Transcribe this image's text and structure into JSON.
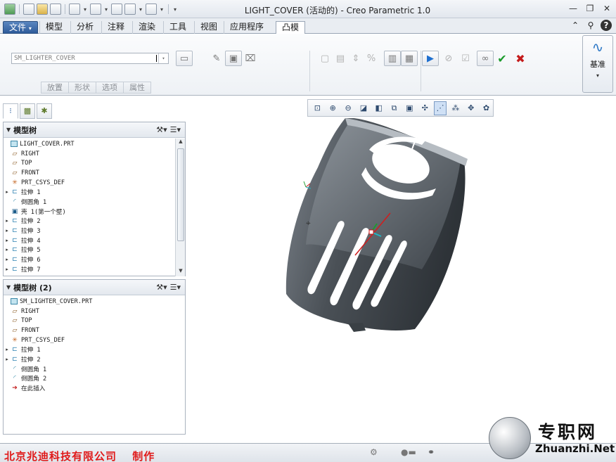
{
  "window": {
    "title": "LIGHT_COVER (活动的) - Creo Parametric 1.0"
  },
  "tabs": [
    {
      "label": "文件",
      "dropdown": "▾"
    },
    {
      "label": "模型"
    },
    {
      "label": "分析"
    },
    {
      "label": "注释"
    },
    {
      "label": "渲染"
    },
    {
      "label": "工具"
    },
    {
      "label": "视图"
    },
    {
      "label": "应用程序"
    },
    {
      "label": "凸模"
    }
  ],
  "ribbon": {
    "combo_value": "SM_LIGHTER_COVER",
    "panel_tabs": [
      "放置",
      "形状",
      "选项",
      "属性"
    ],
    "datum_label": "基准"
  },
  "tree1": {
    "title": "模型树",
    "items": [
      {
        "label": "LIGHT_COVER.PRT",
        "icon": "part-icon",
        "expand": ""
      },
      {
        "label": "RIGHT",
        "icon": "plane-icon",
        "expand": ""
      },
      {
        "label": "TOP",
        "icon": "plane-icon",
        "expand": ""
      },
      {
        "label": "FRONT",
        "icon": "plane-icon",
        "expand": ""
      },
      {
        "label": "PRT_CSYS_DEF",
        "icon": "csys-icon",
        "expand": ""
      },
      {
        "label": "拉伸 1",
        "icon": "extrude-icon",
        "expand": "▸"
      },
      {
        "label": "倒圆角 1",
        "icon": "round-icon",
        "expand": ""
      },
      {
        "label": "壳 1(第一个壁)",
        "icon": "shell-icon",
        "expand": ""
      },
      {
        "label": "拉伸 2",
        "icon": "extrude-icon",
        "expand": "▸"
      },
      {
        "label": "拉伸 3",
        "icon": "extrude-icon",
        "expand": "▸"
      },
      {
        "label": "拉伸 4",
        "icon": "extrude-icon",
        "expand": "▸"
      },
      {
        "label": "拉伸 5",
        "icon": "extrude-icon",
        "expand": "▸"
      },
      {
        "label": "拉伸 6",
        "icon": "extrude-icon",
        "expand": "▸"
      },
      {
        "label": "拉伸 7",
        "icon": "extrude-icon",
        "expand": "▸"
      }
    ]
  },
  "tree2": {
    "title": "模型树 (2)",
    "items": [
      {
        "label": "SM_LIGHTER_COVER.PRT",
        "icon": "part-icon",
        "expand": ""
      },
      {
        "label": "RIGHT",
        "icon": "plane-icon",
        "expand": ""
      },
      {
        "label": "TOP",
        "icon": "plane-icon",
        "expand": ""
      },
      {
        "label": "FRONT",
        "icon": "plane-icon",
        "expand": ""
      },
      {
        "label": "PRT_CSYS_DEF",
        "icon": "csys-icon",
        "expand": ""
      },
      {
        "label": "拉伸 1",
        "icon": "extrude-icon",
        "expand": "▸"
      },
      {
        "label": "拉伸 2",
        "icon": "extrude-icon",
        "expand": "▸"
      },
      {
        "label": "倒圆角 1",
        "icon": "round-icon",
        "expand": ""
      },
      {
        "label": "倒圆角 2",
        "icon": "round-icon",
        "expand": ""
      },
      {
        "label": "在此插入",
        "icon": "insert-here-icon",
        "expand": ""
      }
    ]
  },
  "status": {
    "credit": "北京兆迪科技有限公司　 制作"
  },
  "watermark": {
    "cn": "专职网",
    "url": "Zhuanzhi.Net"
  },
  "colors": {
    "accent": "#2f5c9a",
    "ok": "#1a9a2a",
    "cancel": "#c41b1b",
    "credit": "#e01a1a",
    "model": "#4a5056"
  }
}
